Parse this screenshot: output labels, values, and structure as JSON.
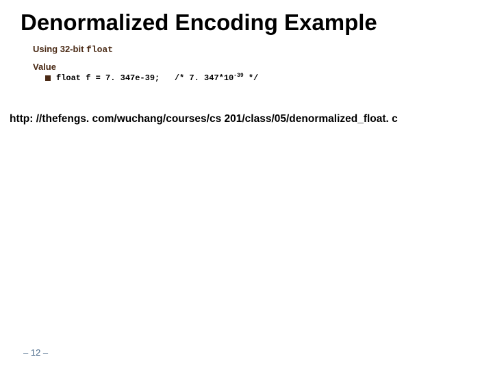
{
  "title": "Denormalized Encoding Example",
  "subtitle_prefix": "Using 32-bit ",
  "subtitle_code": "float",
  "value_label": "Value",
  "code_decl_pre": "float f = 7. 347e-39;   /* 7. 347*10",
  "code_decl_sup": "-39",
  "code_decl_post": " */",
  "url": "http: //thefengs. com/wuchang/courses/cs 201/class/05/denormalized_float. c",
  "page_number": "– 12 –"
}
